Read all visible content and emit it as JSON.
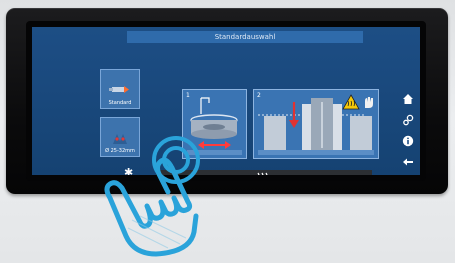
{
  "screen": {
    "title": "Standardauswahl",
    "left_tiles": [
      {
        "label": "Standard",
        "icon": "tool-holder-icon"
      },
      {
        "label": "Ø 25-32mm",
        "icon": "coil-icon"
      }
    ],
    "panels": [
      {
        "number": "1",
        "icon": "coil-rotate-icon"
      },
      {
        "number": "2",
        "icon": "shrink-down-icon",
        "warning_icon": "hot-surface-warning-icon"
      }
    ],
    "side_nav": [
      "home-icon",
      "settings-icon",
      "info-icon",
      "back-icon"
    ],
    "status_icon": "heat-icon",
    "cooling_icon": "snowflake-icon"
  },
  "colors": {
    "screen_bg": "#1d4e85",
    "title_bar": "#2f6bab",
    "panel": "#3a74b3",
    "hand_outline": "#2aa3da",
    "status_bar": "#2c2f33"
  }
}
